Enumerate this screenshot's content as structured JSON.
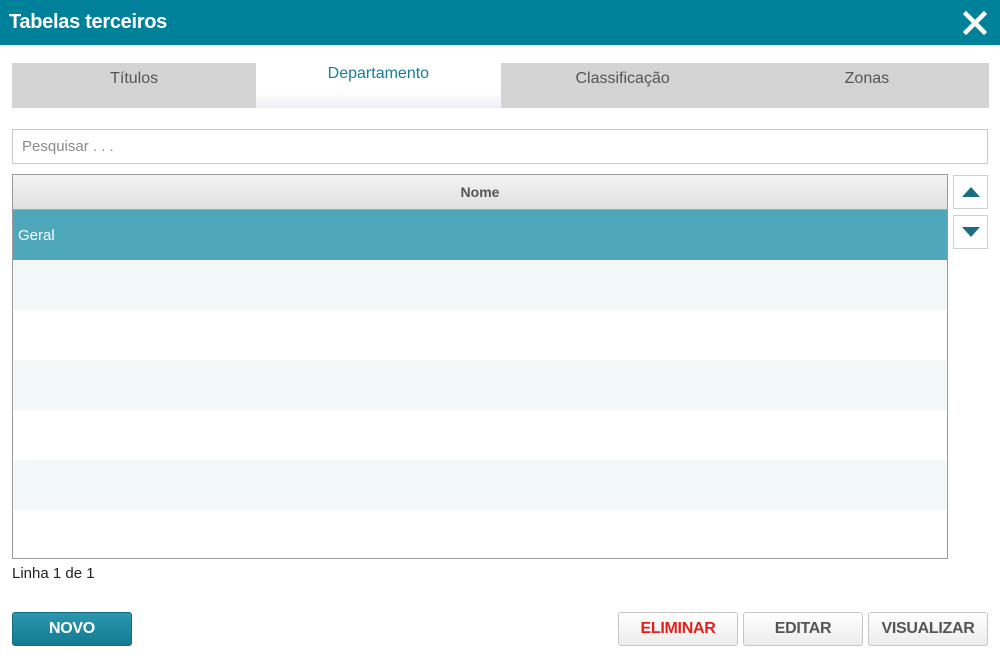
{
  "window": {
    "title": "Tabelas terceiros",
    "close_icon": "close-icon"
  },
  "tabs": [
    {
      "label": "Títulos",
      "active": false
    },
    {
      "label": "Departamento",
      "active": true
    },
    {
      "label": "Classificação",
      "active": false
    },
    {
      "label": "Zonas",
      "active": false
    }
  ],
  "search": {
    "placeholder": "Pesquisar . . .",
    "value": ""
  },
  "grid": {
    "column_header": "Nome",
    "rows": [
      {
        "nome": "Geral",
        "selected": true
      }
    ]
  },
  "move_buttons": {
    "up_icon": "triangle-up-icon",
    "down_icon": "triangle-down-icon"
  },
  "status": "Linha 1 de 1",
  "buttons": {
    "novo": "NOVO",
    "eliminar": "ELIMINAR",
    "editar": "EDITAR",
    "visualizar": "VISUALIZAR"
  },
  "colors": {
    "titlebar": "#00819a",
    "selected_row": "#4ea7ba",
    "active_tab_text": "#1a7d96",
    "danger_text": "#e0211b"
  }
}
